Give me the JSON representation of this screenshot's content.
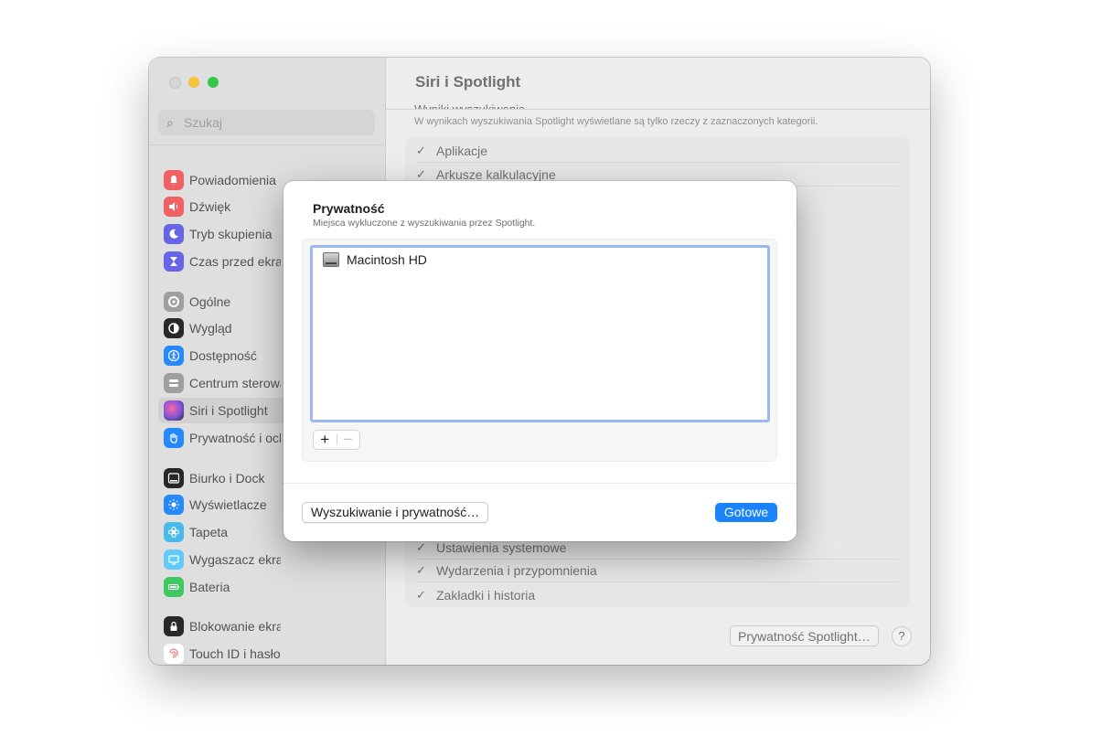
{
  "window": {
    "title": "Siri i Spotlight"
  },
  "sidebar": {
    "search_placeholder": "Szukaj",
    "items": [
      {
        "label": "Powiadomienia",
        "icon": "bell-icon",
        "color": "#f0595c"
      },
      {
        "label": "Dźwięk",
        "icon": "speaker-icon",
        "color": "#f0595c"
      },
      {
        "label": "Tryb skupienia",
        "icon": "moon-icon",
        "color": "#5e5ce6"
      },
      {
        "label": "Czas przed ekranem",
        "icon": "hourglass-icon",
        "color": "#5e5ce6"
      },
      {
        "label": "Ogólne",
        "icon": "gear-icon",
        "color": "#9a9a9a"
      },
      {
        "label": "Wygląd",
        "icon": "appearance-icon",
        "color": "#1d1d1f"
      },
      {
        "label": "Dostępność",
        "icon": "accessibility-icon",
        "color": "#1a82fb"
      },
      {
        "label": "Centrum sterowania",
        "icon": "control-center-icon",
        "color": "#9a9a9a"
      },
      {
        "label": "Siri i Spotlight",
        "icon": "siri-icon",
        "color": "#7a4bd8",
        "selected": true
      },
      {
        "label": "Prywatność i ochrona",
        "icon": "hand-icon",
        "color": "#1a82fb"
      },
      {
        "label": "Biurko i Dock",
        "icon": "dock-icon",
        "color": "#1d1d1f"
      },
      {
        "label": "Wyświetlacze",
        "icon": "sun-icon",
        "color": "#1a82fb"
      },
      {
        "label": "Tapeta",
        "icon": "flower-icon",
        "color": "#3fb7e8"
      },
      {
        "label": "Wygaszacz ekranu",
        "icon": "screensaver-icon",
        "color": "#5ac8fa"
      },
      {
        "label": "Bateria",
        "icon": "battery-icon",
        "color": "#34c759"
      },
      {
        "label": "Blokowanie ekranu",
        "icon": "lock-icon",
        "color": "#1d1d1f"
      },
      {
        "label": "Touch ID i hasło",
        "icon": "fingerprint-icon",
        "color": "#f0595c"
      }
    ]
  },
  "main": {
    "section_title": "Wyniki wyszukiwania",
    "section_desc": "W wynikach wyszukiwania Spotlight wyświetlane są tylko rzeczy z zaznaczonych kategorii.",
    "categories_top": [
      {
        "label": "Aplikacje",
        "checked": true
      },
      {
        "label": "Arkusze kalkulacyjne",
        "checked": true
      }
    ],
    "categories_bottom": [
      {
        "label": "Ustawienia systemowe",
        "checked": true
      },
      {
        "label": "Wydarzenia i przypomnienia",
        "checked": true
      },
      {
        "label": "Zakładki i historia",
        "checked": true
      }
    ],
    "spotlight_privacy_button": "Prywatność Spotlight…",
    "help_button": "?"
  },
  "dialog": {
    "title": "Prywatność",
    "subtitle": "Miejsca wykluczone z wyszukiwania przez Spotlight.",
    "list_items": [
      {
        "label": "Macintosh HD",
        "icon": "hard-drive-icon"
      }
    ],
    "plus_label": "+",
    "minus_label": "−",
    "left_button": "Wyszukiwanie i prywatność…",
    "done_button": "Gotowe",
    "accent_color": "#1a82fb"
  }
}
